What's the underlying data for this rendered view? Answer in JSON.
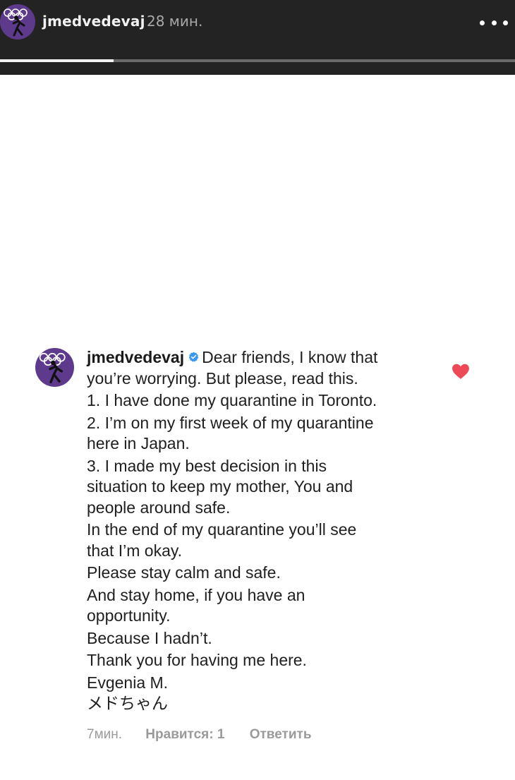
{
  "story": {
    "username": "jmedvedevaj",
    "time": "28 мин.",
    "progress_fraction": 0.22,
    "more_icon": "ellipsis-horizontal-icon"
  },
  "comment": {
    "username": "jmedvedevaj",
    "verified_icon": "verified-badge-icon",
    "first_line": "Dear friends, I know that",
    "lines": [
      "you’re worrying. But please, read this.",
      "1. I have done my quarantine in Toronto.",
      "2. I’m on my first week of my quarantine",
      "here in Japan.",
      "3. I made my best decision in this",
      "situation to keep my mother, You and",
      "people around safe.",
      "In the end of my quarantine you’ll see",
      "that I’m okay.",
      "Please stay calm and safe.",
      "And stay home, if you have an",
      "opportunity.",
      "Because I hadn’t.",
      "Thank you for having me here.",
      "Evgenia M.",
      "メドちゃん"
    ],
    "like_icon": "heart-icon",
    "like_color": "#ed4956",
    "meta": {
      "time": "7мин.",
      "likes": "Нравится: 1",
      "reply": "Ответить"
    }
  },
  "colors": {
    "header_bg": "#232323",
    "avatar_bg": "#5e3a8c",
    "verified_blue": "#3897f0"
  }
}
